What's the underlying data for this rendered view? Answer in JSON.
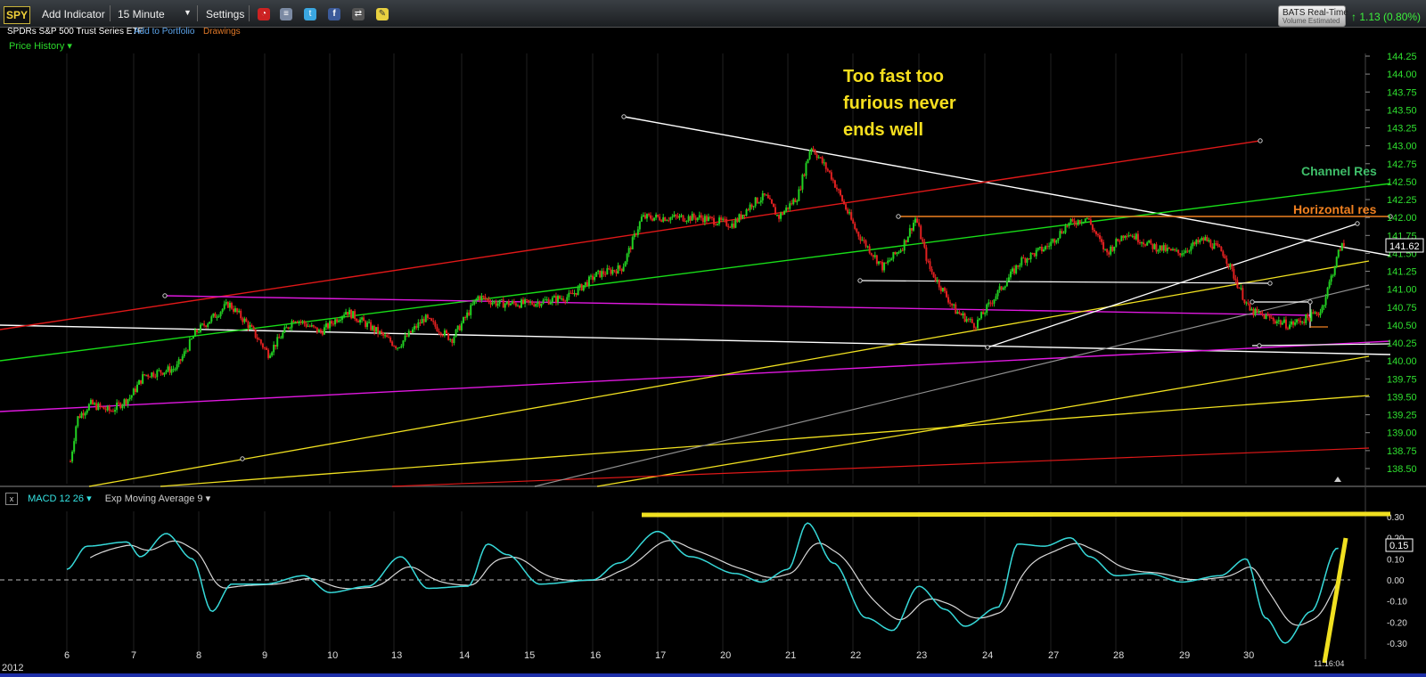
{
  "toolbar": {
    "symbol": "SPY",
    "add_indicator": "Add Indicator",
    "interval": "15 Minute",
    "settings": "Settings",
    "icons": [
      "clock-icon",
      "database-icon",
      "twitter-icon",
      "facebook-icon",
      "share-icon",
      "note-icon"
    ],
    "realtime_line1": "BATS Real-Time",
    "realtime_line2": "Volume Estimated",
    "change": "↑ 1.13 (0.80%)"
  },
  "subheader": {
    "name": "SPDRs S&P 500 Trust Series ETF",
    "add_portfolio": "Add to Portfolio",
    "drawings": "Drawings",
    "price_history": "Price History ▾"
  },
  "annotations": {
    "headline": [
      "Too fast too",
      "furious never",
      "ends well"
    ],
    "channel_res": "Channel Res",
    "horizontal_res": "Horizontal res"
  },
  "price_axis": {
    "ticks": [
      "144.25",
      "144.00",
      "143.75",
      "143.50",
      "143.25",
      "143.00",
      "142.75",
      "142.50",
      "142.25",
      "142.00",
      "141.75",
      "141.50",
      "141.25",
      "141.00",
      "140.75",
      "140.50",
      "140.25",
      "140.00",
      "139.75",
      "139.50",
      "139.25",
      "139.00",
      "138.75",
      "138.50"
    ],
    "last_price": "141.62"
  },
  "macd_panel": {
    "close": "x",
    "label": "MACD 12 26 ▾",
    "ema_label": "Exp Moving Average 9 ▾",
    "axis_ticks": [
      "0.30",
      "0.20",
      "0.10",
      "0.00",
      "-0.10",
      "-0.20",
      "-0.30"
    ],
    "last_value": "0.15"
  },
  "x_axis": {
    "labels": [
      "6",
      "7",
      "8",
      "9",
      "10",
      "13",
      "14",
      "15",
      "16",
      "17",
      "20",
      "21",
      "22",
      "23",
      "24",
      "27",
      "28",
      "29",
      "30"
    ],
    "year": "2012",
    "time": "11:16:04"
  },
  "colors": {
    "bull": "#22d022",
    "bear": "#e02020",
    "green_line": "#18dd18",
    "red_line": "#e01818",
    "magenta": "#e018e0",
    "yellow": "#f0e020",
    "orange": "#f08020",
    "macd": "#36d9d9",
    "signal": "#d8d8d8",
    "annotation_yellow": "#f6df1e",
    "channel_green": "#3fbf6a"
  },
  "chart_data": {
    "type": "candlestick",
    "ylim": [
      138.3,
      144.3
    ],
    "x_labels": [
      "6",
      "7",
      "8",
      "9",
      "10",
      "13",
      "14",
      "15",
      "16",
      "17",
      "20",
      "21",
      "22",
      "23",
      "24",
      "27",
      "28",
      "29",
      "30"
    ],
    "path_points": [
      [
        0,
        138.6
      ],
      [
        0.1,
        139.2
      ],
      [
        0.3,
        139.4
      ],
      [
        0.6,
        139.3
      ],
      [
        0.9,
        139.5
      ],
      [
        1.1,
        139.8
      ],
      [
        1.6,
        139.9
      ],
      [
        1.9,
        140.4
      ],
      [
        2.4,
        140.8
      ],
      [
        2.7,
        140.5
      ],
      [
        3.0,
        140.1
      ],
      [
        3.4,
        140.6
      ],
      [
        3.8,
        140.4
      ],
      [
        4.2,
        140.7
      ],
      [
        4.7,
        140.4
      ],
      [
        5.0,
        140.2
      ],
      [
        5.4,
        140.6
      ],
      [
        5.8,
        140.3
      ],
      [
        6.2,
        140.9
      ],
      [
        6.5,
        140.8
      ],
      [
        7.0,
        140.8
      ],
      [
        7.6,
        140.9
      ],
      [
        8.0,
        141.2
      ],
      [
        8.4,
        141.3
      ],
      [
        8.7,
        142.0
      ],
      [
        9.2,
        142.0
      ],
      [
        9.6,
        142.0
      ],
      [
        10.1,
        141.9
      ],
      [
        10.4,
        142.2
      ],
      [
        10.6,
        142.3
      ],
      [
        10.8,
        142.0
      ],
      [
        11.1,
        142.3
      ],
      [
        11.3,
        143.0
      ],
      [
        11.6,
        142.6
      ],
      [
        12.0,
        141.8
      ],
      [
        12.4,
        141.3
      ],
      [
        12.7,
        141.6
      ],
      [
        12.9,
        142.0
      ],
      [
        13.1,
        141.3
      ],
      [
        13.5,
        140.7
      ],
      [
        13.8,
        140.5
      ],
      [
        14.1,
        140.9
      ],
      [
        14.5,
        141.4
      ],
      [
        14.9,
        141.6
      ],
      [
        15.2,
        141.9
      ],
      [
        15.5,
        142.0
      ],
      [
        15.8,
        141.5
      ],
      [
        16.1,
        141.8
      ],
      [
        16.5,
        141.6
      ],
      [
        16.9,
        141.5
      ],
      [
        17.3,
        141.7
      ],
      [
        17.6,
        141.5
      ],
      [
        18.0,
        140.7
      ],
      [
        18.3,
        140.6
      ],
      [
        18.6,
        140.5
      ],
      [
        18.9,
        140.6
      ],
      [
        19.1,
        140.7
      ],
      [
        19.4,
        141.6
      ]
    ],
    "macd": {
      "signal_line_level": 0.3,
      "ylim": [
        -0.33,
        0.33
      ]
    },
    "price_levels": {
      "horizontal_res": 142.0,
      "last": 141.62
    },
    "grid": true
  }
}
